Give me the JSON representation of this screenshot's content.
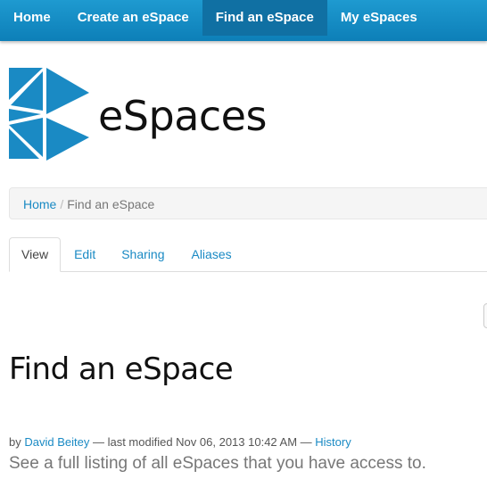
{
  "nav": {
    "items": [
      {
        "label": "Home"
      },
      {
        "label": "Create an eSpace"
      },
      {
        "label": "Find an eSpace",
        "active": true
      },
      {
        "label": "My eSpaces"
      }
    ]
  },
  "logo": {
    "text": "eSpaces",
    "icon": "espaces-triangle-logo",
    "color": "#1a8ac4"
  },
  "breadcrumb": {
    "home": "Home",
    "separator": "/",
    "current": "Find an eSpace"
  },
  "tabs": [
    {
      "label": "View",
      "active": true
    },
    {
      "label": "Edit"
    },
    {
      "label": "Sharing"
    },
    {
      "label": "Aliases"
    }
  ],
  "page": {
    "title": "Find an eSpace",
    "byline": {
      "by": "by",
      "author": "David Beitey",
      "modified": "— last modified Nov 06, 2013 10:42 AM —",
      "history": "History"
    },
    "description": "See a full listing of all eSpaces that you have access to."
  },
  "colors": {
    "nav_bg": "#1e9ad0",
    "nav_active": "#1070a3",
    "link": "#1a8ac4"
  }
}
